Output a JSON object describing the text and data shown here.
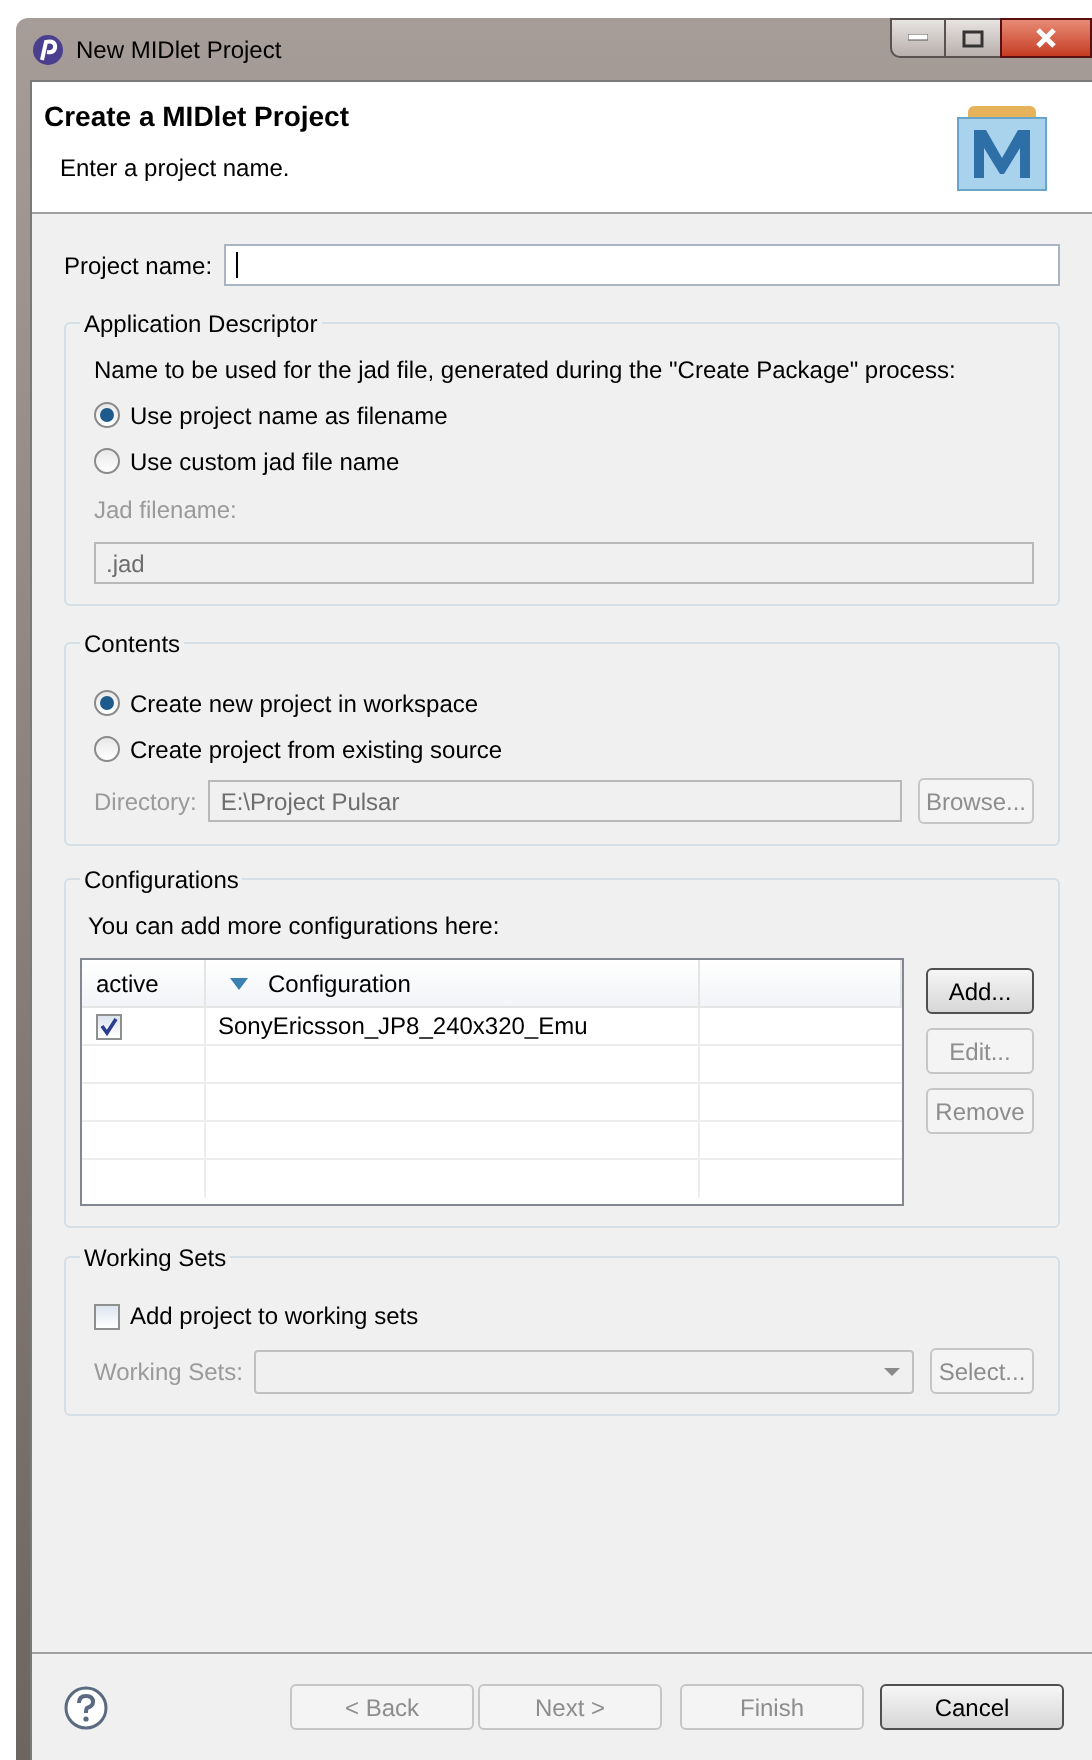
{
  "window": {
    "title": "New MIDlet Project"
  },
  "header": {
    "title": "Create a MIDlet Project",
    "subtitle": "Enter a project name."
  },
  "project_name": {
    "label": "Project name:"
  },
  "application_descriptor": {
    "title": "Application Descriptor",
    "description": "Name to be used for the jad file, generated during the \"Create Package\" process:",
    "options": [
      {
        "label": "Use project name as filename",
        "selected": true
      },
      {
        "label": "Use custom jad file name",
        "selected": false
      }
    ],
    "jad_field": {
      "label": "Jad filename:",
      "value": ".jad",
      "disabled": true
    }
  },
  "contents": {
    "title": "Contents",
    "options": [
      {
        "label": "Create new project in workspace",
        "selected": true
      },
      {
        "label": "Create project from existing source",
        "selected": false
      }
    ],
    "directory": {
      "label": "Directory:",
      "value": "E:\\Project Pulsar",
      "disabled": true
    },
    "browse_button": {
      "label": "Browse...",
      "disabled": true
    }
  },
  "configurations": {
    "title": "Configurations",
    "description": "You can add more configurations here:",
    "columns": [
      {
        "label": "active",
        "sorted": false
      },
      {
        "label": "Configuration",
        "sorted": true
      }
    ],
    "rows": [
      {
        "active": true,
        "configuration": "SonyEricsson_JP8_240x320_Emu"
      }
    ],
    "buttons": [
      {
        "label": "Add...",
        "disabled": false,
        "default": true
      },
      {
        "label": "Edit...",
        "disabled": true
      },
      {
        "label": "Remove",
        "disabled": true
      }
    ]
  },
  "working_sets": {
    "title": "Working Sets",
    "checkbox": {
      "label": "Add project to working sets",
      "checked": false
    },
    "field": {
      "label": "Working Sets:",
      "disabled": true
    },
    "select_button": {
      "label": "Select...",
      "disabled": true
    }
  },
  "footer_buttons": [
    {
      "label": "< Back",
      "disabled": true
    },
    {
      "label": "Next >",
      "disabled": true
    },
    {
      "label": "Finish",
      "disabled": true
    },
    {
      "label": "Cancel",
      "disabled": false,
      "default": true
    }
  ]
}
